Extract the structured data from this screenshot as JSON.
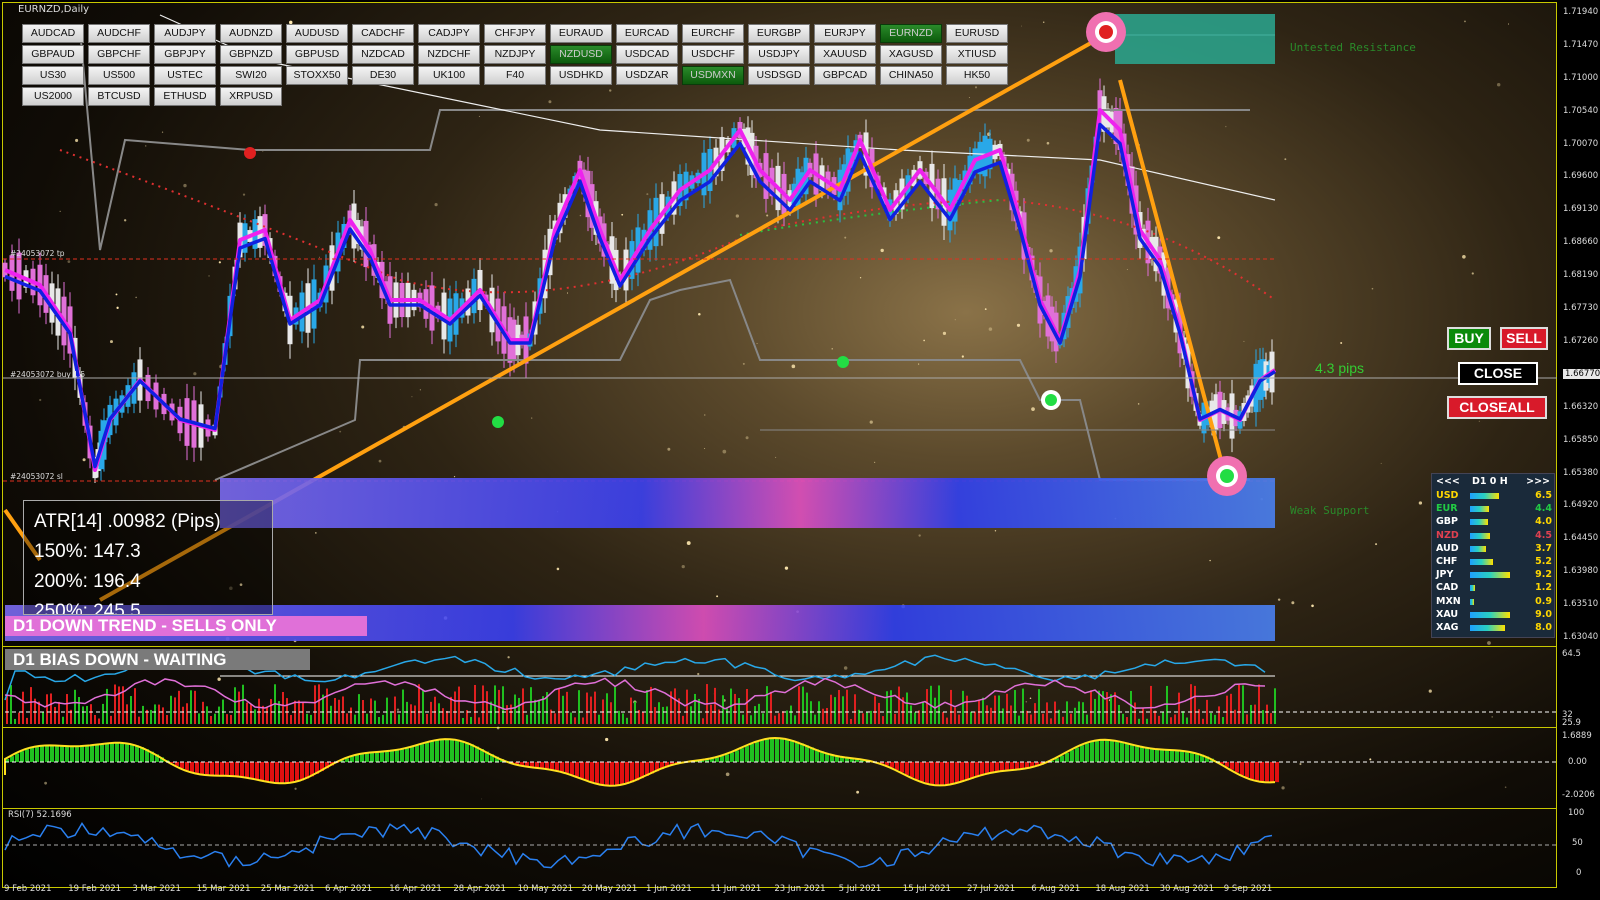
{
  "window": {
    "title": "EURNZD,Daily"
  },
  "symbols": [
    [
      "AUDCAD",
      "AUDCHF",
      "AUDJPY",
      "AUDNZD",
      "AUDUSD",
      "CADCHF",
      "CADJPY",
      "CHFJPY",
      "EURAUD",
      "EURCAD",
      "EURCHF",
      "EURGBP",
      "EURJPY",
      "EURNZD",
      "EURUSD"
    ],
    [
      "GBPAUD",
      "GBPCHF",
      "GBPJPY",
      "GBPNZD",
      "GBPUSD",
      "NZDCAD",
      "NZDCHF",
      "NZDJPY",
      "NZDUSD",
      "USDCAD",
      "USDCHF",
      "USDJPY",
      "XAUUSD",
      "XAGUSD",
      "XTIUSD"
    ],
    [
      "US30",
      "US500",
      "USTEC",
      "SWI20",
      "STOXX50",
      "DE30",
      "UK100",
      "F40",
      "USDHKD",
      "USDZAR",
      "USDMXN",
      "USDSGD",
      "GBPCAD",
      "CHINA50",
      "HK50"
    ],
    [
      "US2000",
      "BTCUSD",
      "ETHUSD",
      "XRPUSD"
    ]
  ],
  "active_symbols": [
    "EURNZD",
    "NZDUSD",
    "USDMXN"
  ],
  "price_axis": [
    "1.71940",
    "1.71470",
    "1.71000",
    "1.70540",
    "1.70070",
    "1.69600",
    "1.69130",
    "1.68660",
    "1.68190",
    "1.67730",
    "1.67260",
    "1.66770",
    "1.66320",
    "1.65850",
    "1.65380",
    "1.64920",
    "1.64450",
    "1.63980",
    "1.63510",
    "1.63040"
  ],
  "current_price": "1.66770",
  "date_axis": [
    "9 Feb 2021",
    "19 Feb 2021",
    "3 Mar 2021",
    "15 Mar 2021",
    "25 Mar 2021",
    "6 Apr 2021",
    "16 Apr 2021",
    "28 Apr 2021",
    "10 May 2021",
    "20 May 2021",
    "1 Jun 2021",
    "11 Jun 2021",
    "23 Jun 2021",
    "5 Jul 2021",
    "15 Jul 2021",
    "27 Jul 2021",
    "6 Aug 2021",
    "18 Aug 2021",
    "30 Aug 2021",
    "9 Sep 2021"
  ],
  "order_lines": {
    "tp": "#24053072 tp",
    "entry": "#24053072 buy 1.5",
    "sl": "#24053072 sl"
  },
  "atr": {
    "line1": "ATR[14] .00982  (Pips)",
    "line2": "150%: 147.3",
    "line3": "200%: 196.4",
    "line4": "250%: 245.5"
  },
  "trend_label": "D1  DOWN TREND - SELLS ONLY",
  "bias_label": "D1  BIAS DOWN - WAITING",
  "pips_label": "4.3 pips",
  "zones": {
    "resistance": "Untested Resistance",
    "support": "Weak Support"
  },
  "buttons": {
    "buy": "BUY",
    "sell": "SELL",
    "close": "CLOSE",
    "closeall": "CLOSEALL"
  },
  "currency_panel": {
    "prev": "<<<",
    "header": "D1  0  H",
    "next": ">>>",
    "rows": [
      {
        "name": "USD",
        "value": "6.5",
        "color": "#ffd700",
        "strength": 0.65
      },
      {
        "name": "EUR",
        "value": "4.4",
        "color": "#22cc44",
        "strength": 0.44
      },
      {
        "name": "GBP",
        "value": "4.0",
        "color": "#ffffff",
        "strength": 0.4
      },
      {
        "name": "NZD",
        "value": "4.5",
        "color": "#e04050",
        "strength": 0.45
      },
      {
        "name": "AUD",
        "value": "3.7",
        "color": "#ffffff",
        "strength": 0.37
      },
      {
        "name": "CHF",
        "value": "5.2",
        "color": "#ffffff",
        "strength": 0.52
      },
      {
        "name": "JPY",
        "value": "9.2",
        "color": "#ffffff",
        "strength": 0.92
      },
      {
        "name": "CAD",
        "value": "1.2",
        "color": "#ffffff",
        "strength": 0.12
      },
      {
        "name": "MXN",
        "value": "0.9",
        "color": "#ffffff",
        "strength": 0.09
      },
      {
        "name": "XAU",
        "value": "9.0",
        "color": "#ffffff",
        "strength": 0.9
      },
      {
        "name": "XAG",
        "value": "8.0",
        "color": "#ffffff",
        "strength": 0.8
      }
    ]
  },
  "sub1_axis": [
    "64.5",
    "32",
    "25.9"
  ],
  "sub2_axis": [
    "1.6889",
    "0.00",
    "-2.0206"
  ],
  "rsi": {
    "label": "RSI(7) 52.1696",
    "axis": [
      "100",
      "50",
      "0"
    ]
  }
}
